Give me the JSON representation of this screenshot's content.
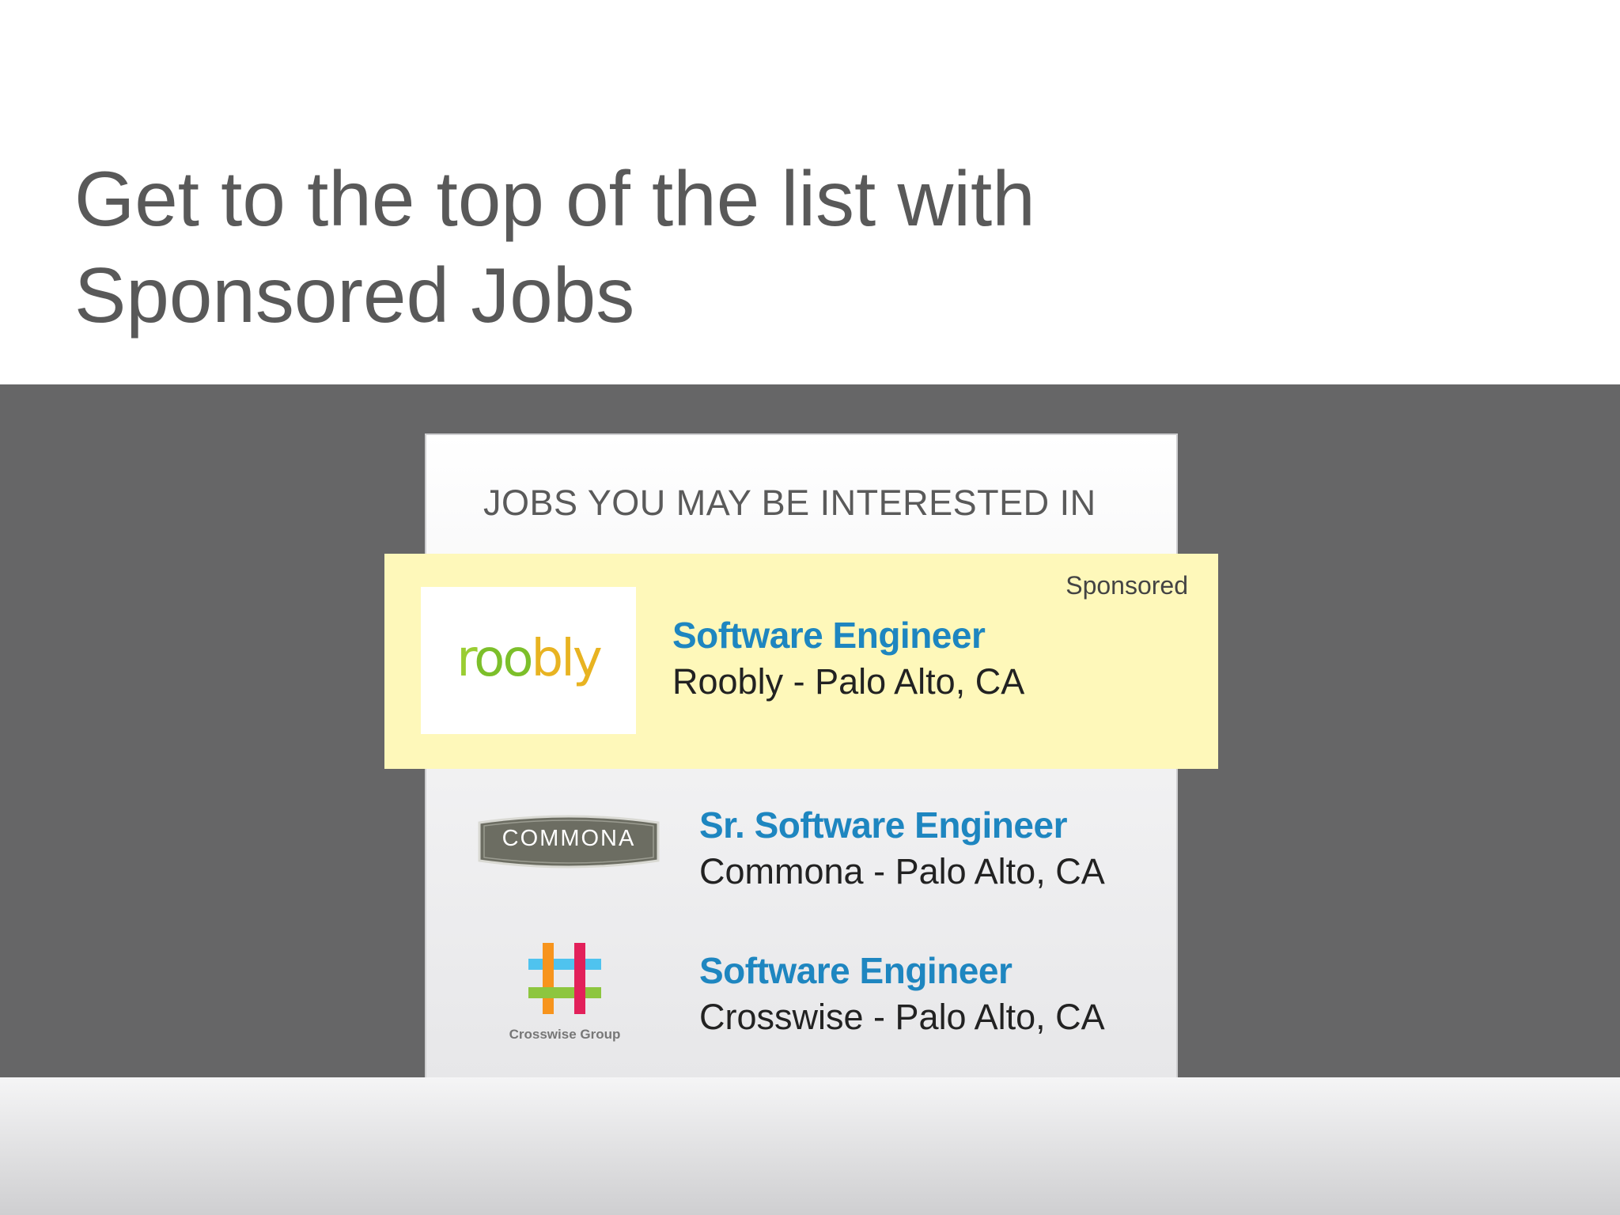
{
  "slide": {
    "title_line1": "Get to the top of the list with",
    "title_line2": "Sponsored Jobs"
  },
  "panel": {
    "heading": "JOBS YOU MAY BE INTERESTED IN"
  },
  "jobs": [
    {
      "sponsored_label": "Sponsored",
      "logo_text_parts": [
        "r",
        "oo",
        "bly"
      ],
      "title": "Software Engineer",
      "meta": "Roobly - Palo Alto, CA"
    },
    {
      "logo_text": "COMMONA",
      "title": "Sr. Software Engineer",
      "meta": "Commona - Palo Alto, CA"
    },
    {
      "logo_caption": "Crosswise Group",
      "title": "Software Engineer",
      "meta": "Crosswise - Palo Alto, CA"
    }
  ],
  "colors": {
    "title_text": "#595959",
    "dark_band": "#666667",
    "sponsored_bg": "#fef8ba",
    "job_link": "#1e86c0",
    "commona_badge": "#6c6d62",
    "crosswise_orange": "#f7941d",
    "crosswise_blue": "#4fc3ef",
    "crosswise_red": "#e2205a",
    "crosswise_green": "#8dc63f"
  },
  "icons": [
    "roobly-logo",
    "commona-logo",
    "crosswise-group-logo"
  ]
}
